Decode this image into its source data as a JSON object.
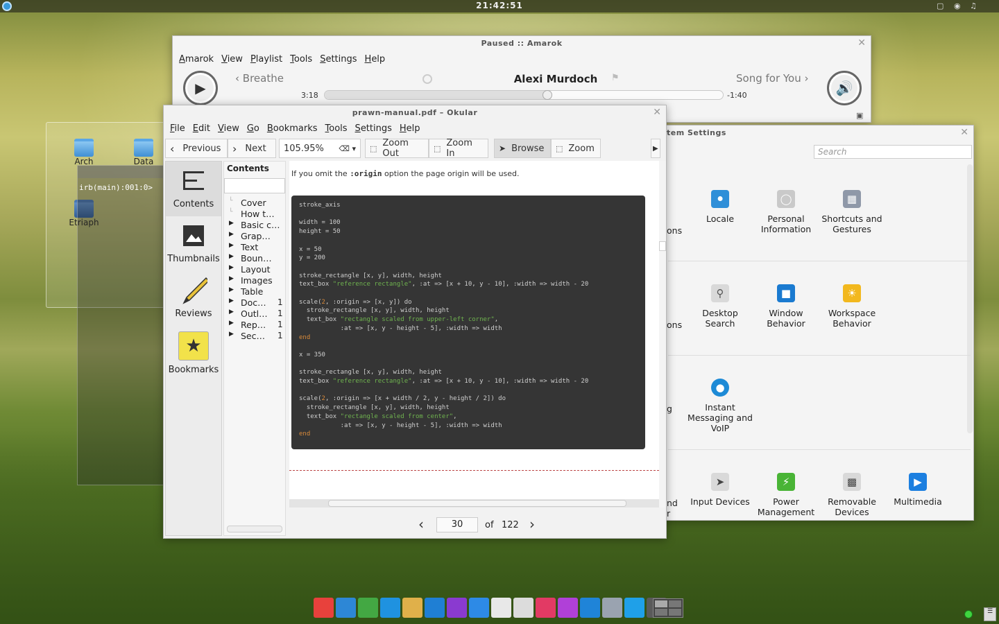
{
  "panel": {
    "clock": "21:42:51"
  },
  "desktop": {
    "icons": [
      "Arch",
      "Data",
      "Etriaph"
    ],
    "terminal_text": "irb(main):001:0> "
  },
  "amarok": {
    "title": "Paused :: Amarok",
    "menu": [
      "Amarok",
      "View",
      "Playlist",
      "Tools",
      "Settings",
      "Help"
    ],
    "prev_track": "Breathe",
    "artist": "Alexi Murdoch",
    "next_track": "Song for You",
    "elapsed": "3:18",
    "remaining": "-1:40",
    "progress": 0.56
  },
  "okular": {
    "title": "prawn-manual.pdf – Okular",
    "menu": [
      "File",
      "Edit",
      "View",
      "Go",
      "Bookmarks",
      "Tools",
      "Settings",
      "Help"
    ],
    "toolbar": {
      "previous": "Previous",
      "next": "Next",
      "zoom_value": "105.95%",
      "zoom_out": "Zoom Out",
      "zoom_in": "Zoom In",
      "browse": "Browse",
      "zoom": "Zoom"
    },
    "sidebar": [
      "Contents",
      "Thumbnails",
      "Reviews",
      "Bookmarks"
    ],
    "toc_header": "Contents",
    "toc": [
      {
        "label": "Cover",
        "page": "",
        "expandable": false
      },
      {
        "label": "How t…",
        "page": "",
        "expandable": false
      },
      {
        "label": "Basic c…",
        "page": "",
        "expandable": true
      },
      {
        "label": "Grap…",
        "page": "",
        "expandable": true
      },
      {
        "label": "Text",
        "page": "",
        "expandable": true
      },
      {
        "label": "Boun…",
        "page": "",
        "expandable": true
      },
      {
        "label": "Layout",
        "page": "",
        "expandable": true
      },
      {
        "label": "Images",
        "page": "",
        "expandable": true
      },
      {
        "label": "Table",
        "page": "",
        "expandable": true
      },
      {
        "label": "Doc…",
        "page": "1",
        "expandable": true
      },
      {
        "label": "Outl…",
        "page": "1",
        "expandable": true
      },
      {
        "label": "Rep…",
        "page": "1",
        "expandable": true
      },
      {
        "label": "Sec…",
        "page": "1",
        "expandable": true
      }
    ],
    "page_text_before": "If you omit the ",
    "page_text_code": ":origin",
    "page_text_after": " option the page origin will be used.",
    "page_number": "30",
    "of_label": "of",
    "total_pages": "122"
  },
  "settings": {
    "title": "tem Settings",
    "search_placeholder": "Search",
    "partial_labels": [
      "ons",
      "ons",
      "g",
      "nd",
      "r"
    ],
    "items": [
      {
        "label": "Locale",
        "icon": "locale-icon",
        "color": "#2f8fd8"
      },
      {
        "label": "Personal Information",
        "icon": "user-icon",
        "color": "#c9c9c9"
      },
      {
        "label": "Shortcuts and Gestures",
        "icon": "keyboard-icon",
        "color": "#8f98a8"
      },
      {
        "label": "Desktop Search",
        "icon": "search-icon",
        "color": "#d9d9d9"
      },
      {
        "label": "Window Behavior",
        "icon": "window-icon",
        "color": "#1a7ad0"
      },
      {
        "label": "Workspace Behavior",
        "icon": "workspace-icon",
        "color": "#f2b81e"
      },
      {
        "label": "Instant Messaging and VoIP",
        "icon": "chat-icon",
        "color": "#1d8ad6"
      },
      {
        "label": "Input Devices",
        "icon": "mouse-icon",
        "color": "#d9d9d9"
      },
      {
        "label": "Power Management",
        "icon": "power-icon",
        "color": "#49b436"
      },
      {
        "label": "Removable Devices",
        "icon": "usb-icon",
        "color": "#d9d9d9"
      },
      {
        "label": "Multimedia",
        "icon": "play-icon",
        "color": "#1c7fe0"
      }
    ]
  },
  "dock": [
    "#e8413c",
    "#2d87d6",
    "#43a843",
    "#1f92e0",
    "#e0b04a",
    "#1f7fd4",
    "#8a3ad0",
    "#2d8ae6",
    "#e8e8e8",
    "#dcdcdc",
    "#e23a64",
    "#b040d8",
    "#1f84d8",
    "#9aa3b0",
    "#1fa0e8",
    "#5a5a5a"
  ]
}
